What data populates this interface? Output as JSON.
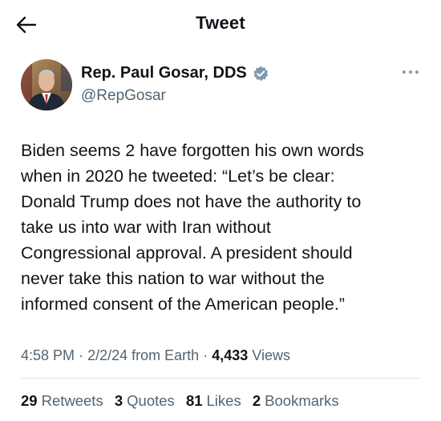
{
  "header": {
    "title": "Tweet",
    "back_icon": "arrow-left-icon"
  },
  "author": {
    "display_name": "Rep. Paul Gosar, DDS",
    "handle": "@RepGosar",
    "verified_icon": "verified-badge-icon",
    "verified_color": "#829aab"
  },
  "more_icon": "more-horizontal-icon",
  "tweet": {
    "lines": [
      "Biden seems 2 have forgotten his own words",
      "when in 2020 he tweeted: “Let’s be clear:",
      "Donald Trump does not have the authority to",
      "take us into war with Iran without",
      "Congressional approval.  A president should",
      "never take this nation to war without the",
      "informed consent of the American people.”"
    ]
  },
  "meta": {
    "time": "4:58 PM",
    "sep1": "·",
    "date": "2/2/24",
    "source": "from Earth",
    "sep2": "·",
    "views_count": "4,433",
    "views_label": "Views"
  },
  "stats": [
    {
      "count": "29",
      "label": "Retweets"
    },
    {
      "count": "3",
      "label": "Quotes"
    },
    {
      "count": "81",
      "label": "Likes"
    },
    {
      "count": "2",
      "label": "Bookmarks"
    }
  ],
  "colors": {
    "text": "#0f1419",
    "secondary": "#536471",
    "divider": "#e1e6ea"
  }
}
